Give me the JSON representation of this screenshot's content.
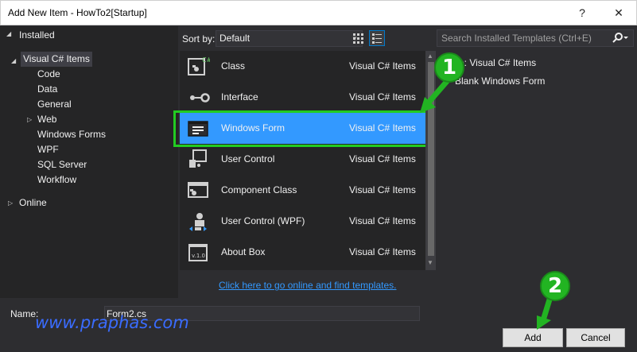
{
  "window": {
    "title": "Add New Item - HowTo2[Startup]",
    "help_glyph": "?",
    "close_glyph": "✕"
  },
  "tree": {
    "installed": "Installed",
    "visual_csharp": "Visual C# Items",
    "children": [
      "Code",
      "Data",
      "General",
      "Web",
      "Windows Forms",
      "WPF",
      "SQL Server",
      "Workflow"
    ],
    "online": "Online"
  },
  "toolbar": {
    "sort_label": "Sort by:",
    "sort_value": "Default"
  },
  "search": {
    "placeholder": "Search Installed Templates (Ctrl+E)"
  },
  "templates": [
    {
      "name": "Class",
      "type": "Visual C# Items",
      "icon": "class-icon"
    },
    {
      "name": "Interface",
      "type": "Visual C# Items",
      "icon": "interface-icon"
    },
    {
      "name": "Windows Form",
      "type": "Visual C# Items",
      "icon": "windows-form-icon",
      "selected": true
    },
    {
      "name": "User Control",
      "type": "Visual C# Items",
      "icon": "user-control-icon"
    },
    {
      "name": "Component Class",
      "type": "Visual C# Items",
      "icon": "component-class-icon"
    },
    {
      "name": "User Control (WPF)",
      "type": "Visual C# Items",
      "icon": "wpf-user-control-icon"
    },
    {
      "name": "About Box",
      "type": "Visual C# Items",
      "icon": "about-box-icon"
    }
  ],
  "details": {
    "type_line": "e:  Visual C# Items",
    "description": "Blank Windows Form"
  },
  "online_link": "Click here to go online and find templates.",
  "name_field": {
    "label": "Name:",
    "value": "Form2.cs"
  },
  "buttons": {
    "add": "Add",
    "cancel": "Cancel"
  },
  "watermark": "www.praphas.com",
  "callouts": [
    "1",
    "2"
  ],
  "colors": {
    "accent_green": "#22b422",
    "selection_blue": "#3399ff"
  }
}
